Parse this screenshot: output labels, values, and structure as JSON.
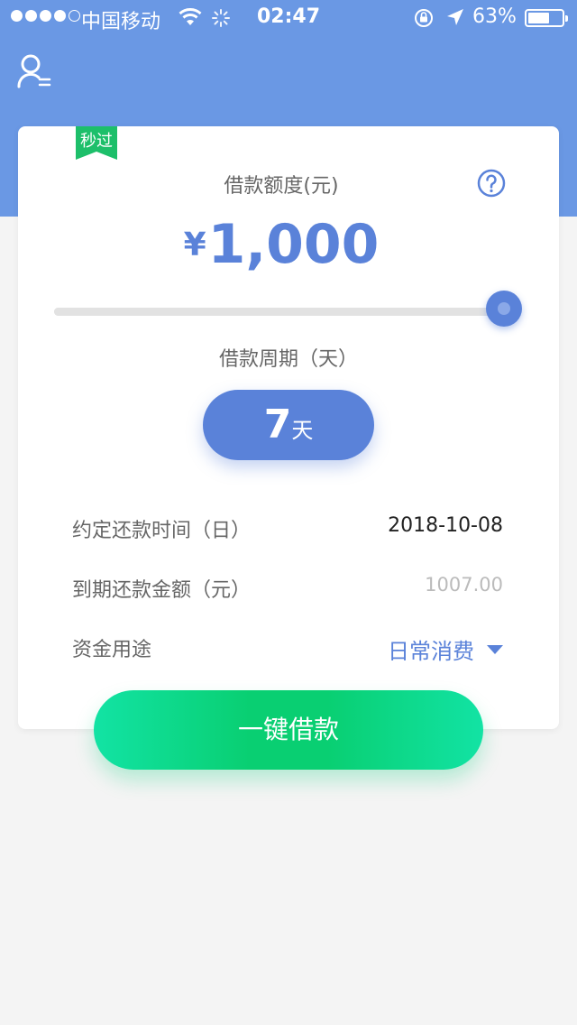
{
  "status_bar": {
    "carrier": "中国移动",
    "time": "02:47",
    "battery_percent": "63%",
    "battery_level": 0.63,
    "signal_bars_filled": 4,
    "signal_bars_total": 5
  },
  "header": {
    "profile_icon": "user-menu-icon"
  },
  "card": {
    "badge": "秒过",
    "amount_label": "借款额度(元)",
    "amount_currency": "¥",
    "amount_value": "1,000",
    "slider_fraction": 1.0,
    "period_label": "借款周期（天）",
    "period_value": "7",
    "period_unit": "天",
    "rows": [
      {
        "label": "约定还款时间（日）",
        "value": "2018-10-08"
      },
      {
        "label": "到期还款金额（元）",
        "value": "1007.00"
      },
      {
        "label": "资金用途",
        "value": "日常消费"
      }
    ]
  },
  "cta_label": "一键借款",
  "colors": {
    "header_bg": "#6a98e4",
    "accent": "#5a82d9",
    "cta": "#09cf72",
    "badge": "#1dbf6a"
  }
}
